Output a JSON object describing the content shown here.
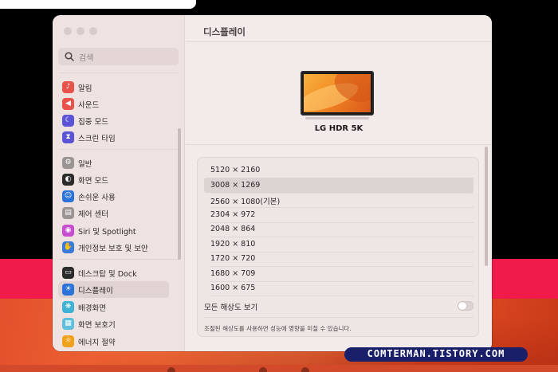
{
  "sidebar": {
    "search_placeholder": "검색",
    "items": [
      {
        "label": "알림",
        "icon": "bell-icon",
        "color": "#e8524a",
        "glyph": "♪"
      },
      {
        "label": "사운드",
        "icon": "speaker-icon",
        "color": "#e8524a",
        "glyph": "◀"
      },
      {
        "label": "집중 모드",
        "icon": "moon-icon",
        "color": "#5b55d6",
        "glyph": "☾"
      },
      {
        "label": "스크린 타임",
        "icon": "hourglass-icon",
        "color": "#5b55d6",
        "glyph": "⧗"
      },
      {
        "label": "일반",
        "icon": "gear-icon",
        "color": "#9a9493",
        "glyph": "⚙"
      },
      {
        "label": "화면 모드",
        "icon": "appearance-icon",
        "color": "#2b2b2b",
        "glyph": "◐"
      },
      {
        "label": "손쉬운 사용",
        "icon": "accessibility-icon",
        "color": "#2b73d9",
        "glyph": "☺"
      },
      {
        "label": "제어 센터",
        "icon": "control-center-icon",
        "color": "#9a9493",
        "glyph": "▤"
      },
      {
        "label": "Siri 및 Spotlight",
        "icon": "siri-icon",
        "color": "#c64fd1",
        "glyph": "◉"
      },
      {
        "label": "개인정보 보호 및 보안",
        "icon": "hand-icon",
        "color": "#3a7bd9",
        "glyph": "✋"
      },
      {
        "label": "데스크탑 및 Dock",
        "icon": "dock-icon",
        "color": "#2b2b2b",
        "glyph": "▭"
      },
      {
        "label": "디스플레이",
        "icon": "sun-icon",
        "color": "#2b73d9",
        "glyph": "☀"
      },
      {
        "label": "배경화면",
        "icon": "wallpaper-icon",
        "color": "#3fb3d6",
        "glyph": "❋"
      },
      {
        "label": "화면 보호기",
        "icon": "screensaver-icon",
        "color": "#5fc0dc",
        "glyph": "▦"
      },
      {
        "label": "에너지 절약",
        "icon": "bulb-icon",
        "color": "#f0a11a",
        "glyph": "☼"
      }
    ]
  },
  "main": {
    "title": "디스플레이",
    "monitor_name": "LG HDR 5K",
    "resolutions": [
      "5120 × 2160",
      "3008 × 1269",
      "2560 × 1080(기본)",
      "2304 × 972",
      "2048 × 864",
      "1920 × 810",
      "1720 × 720",
      "1680 × 709",
      "1600 × 675"
    ],
    "selected_resolution": "3008 × 1269",
    "show_all_label": "모든 해상도 보기",
    "show_all_enabled": false,
    "note": "조절된 해상도를 사용하면 성능에 영향을 미칠 수 있습니다."
  },
  "watermark": "COMTERMAN.TISTORY.COM"
}
